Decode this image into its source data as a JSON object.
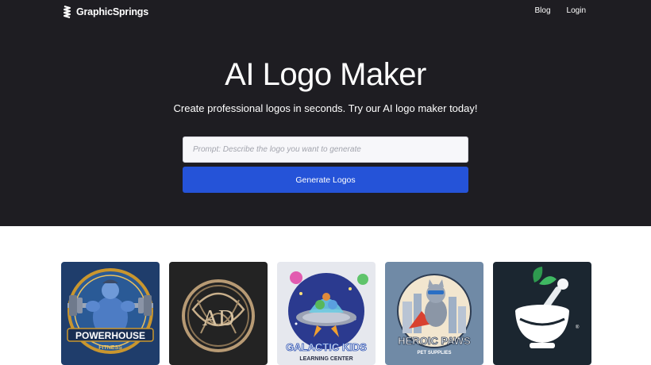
{
  "header": {
    "brand": "GraphicSprings",
    "nav": [
      {
        "label": "Blog"
      },
      {
        "label": "Login"
      }
    ]
  },
  "hero": {
    "title": "AI Logo Maker",
    "subtitle": "Create professional logos in seconds. Try our AI logo maker today!",
    "prompt_placeholder": "Prompt: Describe the logo you want to generate",
    "prompt_value": "",
    "generate_label": "Generate Logos"
  },
  "gallery": {
    "items": [
      {
        "logo_text": "POWERHOUSE",
        "logo_subtext": "FITNESS",
        "background": "#1f3d6b"
      },
      {
        "logo_text": "AD",
        "background": "#232323"
      },
      {
        "logo_text": "GALACTIC KIDS",
        "logo_subtext": "LEARNING CENTER",
        "background": "#e6e8ee"
      },
      {
        "logo_text": "HEROIC PAWS",
        "logo_subtext": "PET SUPPLIES",
        "background": "#708aa6"
      },
      {
        "background": "#1b2630"
      }
    ]
  },
  "colors": {
    "hero_bg": "#1e1d22",
    "accent": "#2553d8",
    "page_bg": "#ffffff"
  }
}
